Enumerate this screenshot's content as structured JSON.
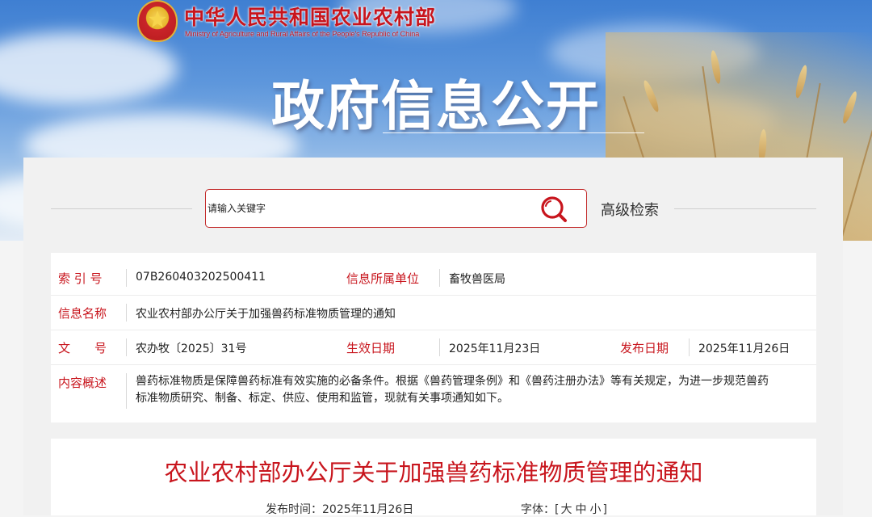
{
  "header": {
    "ministry_cn": "中华人民共和国农业农村部",
    "ministry_en": "Ministry of Agriculture and Rural Affairs of the People's Republic of China",
    "section_title": "政府信息公开"
  },
  "search": {
    "placeholder": "请输入关键字",
    "advanced_label": "高级检索"
  },
  "info": {
    "index_label": "索 引 号",
    "index_value": "07B260403202500411",
    "unit_label": "信息所属单位",
    "unit_value": "畜牧兽医局",
    "name_label": "信息名称",
    "name_value": "农业农村部办公厅关于加强兽药标准物质管理的通知",
    "docno_label_a": "文",
    "docno_label_b": "号",
    "docno_value": "农办牧〔2025〕31号",
    "effective_label": "生效日期",
    "effective_value": "2025年11月23日",
    "publish_label": "发布日期",
    "publish_value": "2025年11月26日",
    "summary_label": "内容概述",
    "summary_line1": "兽药标准物质是保障兽药标准有效实施的必备条件。根据《兽药管理条例》和《兽药注册办法》等有关规定，为进一步规范兽药",
    "summary_line2": "标准物质研究、制备、标定、供应、使用和监管，现就有关事项通知如下。"
  },
  "article": {
    "title": "农业农村部办公厅关于加强兽药标准物质管理的通知",
    "publish_time_label": "发布时间：",
    "publish_time_value": "2025年11月26日",
    "font_label": "字体：",
    "font_open": "[",
    "font_large": "大",
    "font_medium": "中",
    "font_small": "小",
    "font_close": "]"
  },
  "colors": {
    "accent_red": "#c8151d",
    "search_border": "#c32b2b",
    "banner_sky": "#5e97dc"
  }
}
